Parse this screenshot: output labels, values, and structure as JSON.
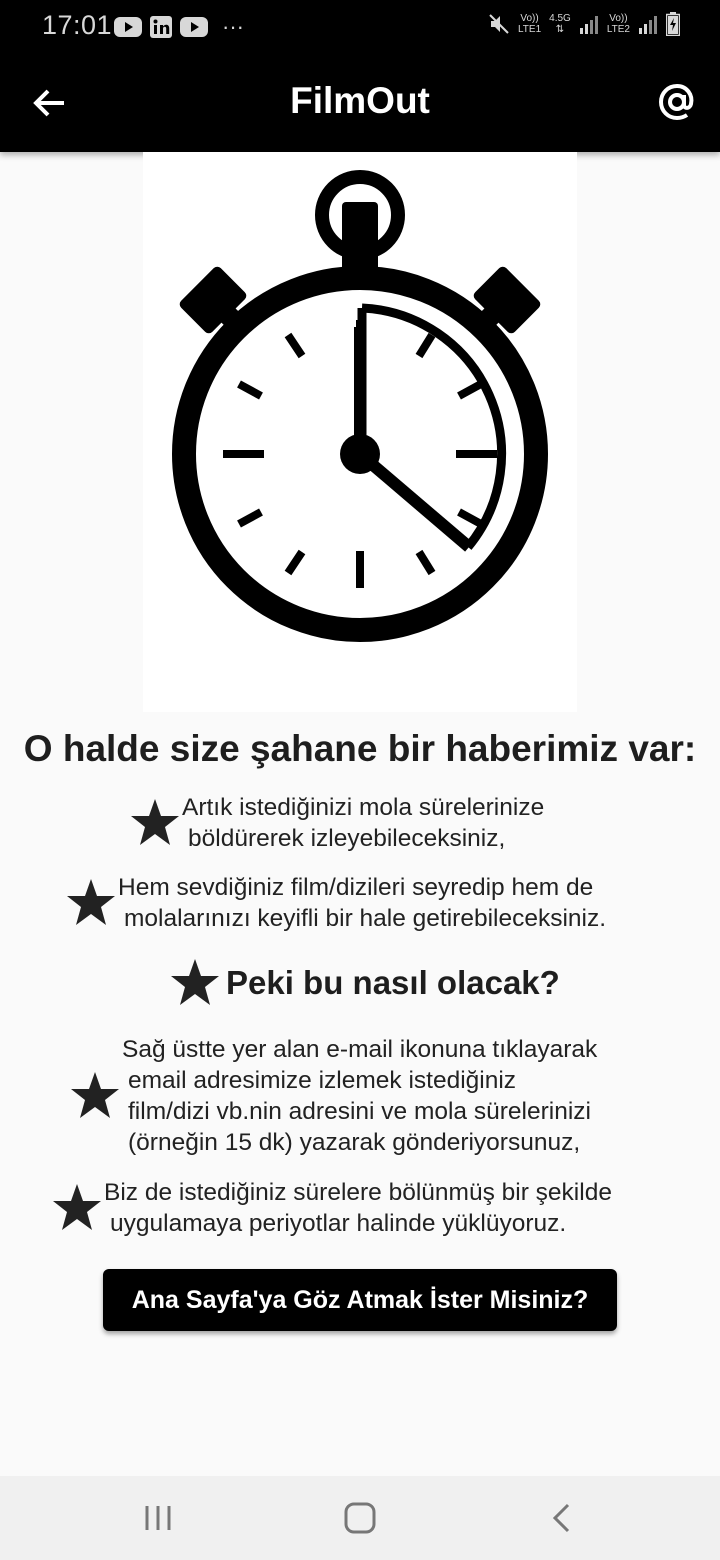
{
  "status_bar": {
    "time": "17:01",
    "more": "···",
    "sim1_label": "Vo))",
    "sim1_net": "LTE1",
    "sim1_gen": "4.5G",
    "sim2_label": "Vo))",
    "sim2_net": "LTE2",
    "icons": [
      "youtube-icon",
      "linkedin-icon",
      "youtube-icon",
      "mute-icon",
      "signal-icon",
      "battery-icon"
    ]
  },
  "app_bar": {
    "title": "FilmOut",
    "back_icon": "arrow-left-icon",
    "email_icon": "at-sign-icon"
  },
  "hero": {
    "icon": "stopwatch-icon"
  },
  "content": {
    "headline": "O halde size şahane bir haberimiz var:",
    "bullets_1": [
      {
        "line1": "Artık istediğinizi mola sürelerinize",
        "line2": "böldürerek izleyebileceksiniz,"
      },
      {
        "line1": "Hem sevdiğiniz film/dizileri seyredip hem de",
        "line2": "molalarınızı keyifli bir hale getirebileceksiniz."
      }
    ],
    "sub_heading": "Peki bu nasıl olacak?",
    "bullets_2": [
      {
        "line1": "Sağ üstte yer alan e-mail ikonuna tıklayarak",
        "line2": "email adresimize izlemek istediğiniz",
        "line3": "film/dizi vb.nin adresini ve mola sürelerinizi",
        "line4": "(örneğin 15 dk) yazarak gönderiyorsunuz,"
      },
      {
        "line1": "Biz de istediğiniz sürelere bölünmüş bir şekilde",
        "line2": "uygulamaya periyotlar halinde yüklüyoruz."
      }
    ],
    "cta_label": "Ana Sayfa'ya Göz Atmak İster Misiniz?"
  },
  "nav_bar": {
    "icons": [
      "recent-apps-icon",
      "home-icon",
      "back-icon"
    ]
  },
  "colors": {
    "app_bar": "#000000",
    "background": "#fafafa",
    "text": "#1e1e1e",
    "button": "#000000"
  }
}
